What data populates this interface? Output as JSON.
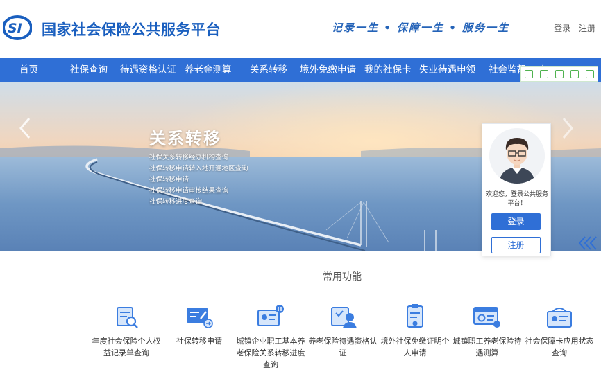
{
  "header": {
    "logo_text": "SI",
    "site_title": "国家社会保险公共服务平台",
    "slogan": "记录一生 • 保障一生 • 服务一生",
    "login_link": "登录",
    "register_link": "注册"
  },
  "nav": {
    "items": [
      {
        "label": "首页"
      },
      {
        "label": "社保查询"
      },
      {
        "label": "待遇资格认证"
      },
      {
        "label": "养老金测算"
      },
      {
        "label": "关系转移"
      },
      {
        "label": "境外免缴申请"
      },
      {
        "label": "我的社保卡"
      },
      {
        "label": "失业待遇申领"
      },
      {
        "label": "社会监督"
      },
      {
        "label": "包"
      }
    ]
  },
  "banner": {
    "title": "关系转移",
    "links": [
      "社保关系转移经办机构查询",
      "社保转移申请转入地开通地区查询",
      "社保转移申请",
      "社保转移申请审核结果查询",
      "社保转移进度查询"
    ]
  },
  "login_card": {
    "welcome": "欢迎您，登录公共服务平台！",
    "login_button": "登录",
    "register_button": "注册"
  },
  "common": {
    "title": "常用功能",
    "items": [
      {
        "label": "年度社会保险个人权益记录单查询",
        "icon": "record-search-icon"
      },
      {
        "label": "社保转移申请",
        "icon": "transfer-apply-icon"
      },
      {
        "label": "城镇企业职工基本养老保险关系转移进度查询",
        "icon": "pension-transfer-icon"
      },
      {
        "label": "养老保险待遇资格认证",
        "icon": "qualification-icon"
      },
      {
        "label": "境外社保免缴证明个人申请",
        "icon": "overseas-exemption-icon"
      },
      {
        "label": "城镇职工养老保险待遇测算",
        "icon": "pension-calc-icon"
      },
      {
        "label": "社会保障卡应用状态查询",
        "icon": "card-status-icon"
      }
    ]
  },
  "colors": {
    "brand_blue": "#2f6fd6",
    "title_blue": "#1a5fbf",
    "icon_blue": "#3b7de0"
  }
}
